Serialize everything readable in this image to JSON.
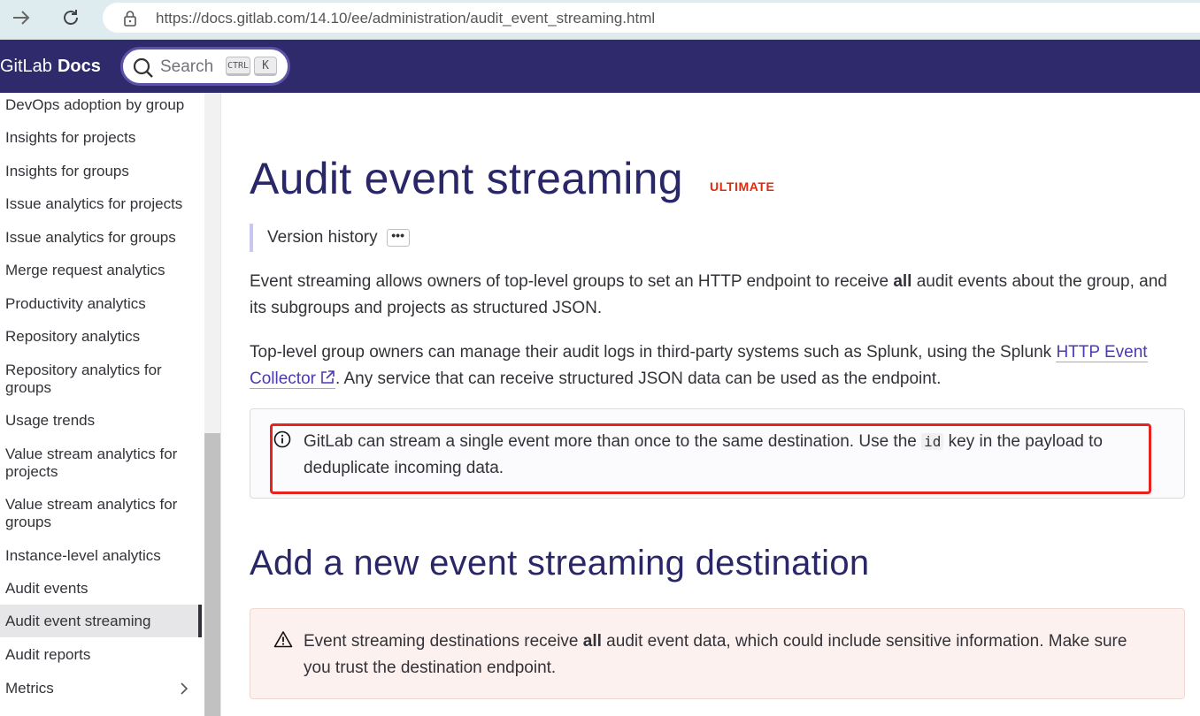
{
  "browser": {
    "url": "https://docs.gitlab.com/14.10/ee/administration/audit_event_streaming.html"
  },
  "header": {
    "logo_text": "GitLab",
    "logo_bold": "Docs",
    "search_label": "Search",
    "kbd_ctrl": "CTRL",
    "kbd_k": "K"
  },
  "sidebar": {
    "items": [
      {
        "label": "DevOps adoption by group"
      },
      {
        "label": "Insights for projects"
      },
      {
        "label": "Insights for groups"
      },
      {
        "label": "Issue analytics for projects"
      },
      {
        "label": "Issue analytics for groups"
      },
      {
        "label": "Merge request analytics"
      },
      {
        "label": "Productivity analytics"
      },
      {
        "label": "Repository analytics"
      },
      {
        "label": "Repository analytics for groups"
      },
      {
        "label": "Usage trends"
      },
      {
        "label": "Value stream analytics for projects"
      },
      {
        "label": "Value stream analytics for groups"
      },
      {
        "label": "Instance-level analytics"
      },
      {
        "label": "Audit events"
      },
      {
        "label": "Audit event streaming"
      },
      {
        "label": "Audit reports"
      },
      {
        "label": "Metrics"
      }
    ]
  },
  "main": {
    "title": "Audit event streaming",
    "tier": "ULTIMATE",
    "version_history": "Version history",
    "version_history_toggle": "•••",
    "para1_a": "Event streaming allows owners of top-level groups to set an HTTP endpoint to receive ",
    "para1_bold": "all",
    "para1_b": " audit events about the group, and its subgroups and projects as structured JSON.",
    "para2_a": "Top-level group owners can manage their audit logs in third-party systems such as Splunk, using the Splunk ",
    "para2_link": "HTTP Event Collector",
    "para2_b": ". Any service that can receive structured JSON data can be used as the endpoint.",
    "info_a": "GitLab can stream a single event more than once to the same destination. Use the ",
    "info_code": "id",
    "info_b": " key in the payload to deduplicate incoming data.",
    "h2": "Add a new event streaming destination",
    "warn_a": "Event streaming destinations receive ",
    "warn_bold": "all",
    "warn_b": " audit event data, which could include sensitive information. Make sure you trust the destination endpoint."
  },
  "colors": {
    "header_bg": "#2f2a6b",
    "heading": "#2a2768",
    "tier": "#dd2b0e",
    "highlight": "#e8231f"
  }
}
